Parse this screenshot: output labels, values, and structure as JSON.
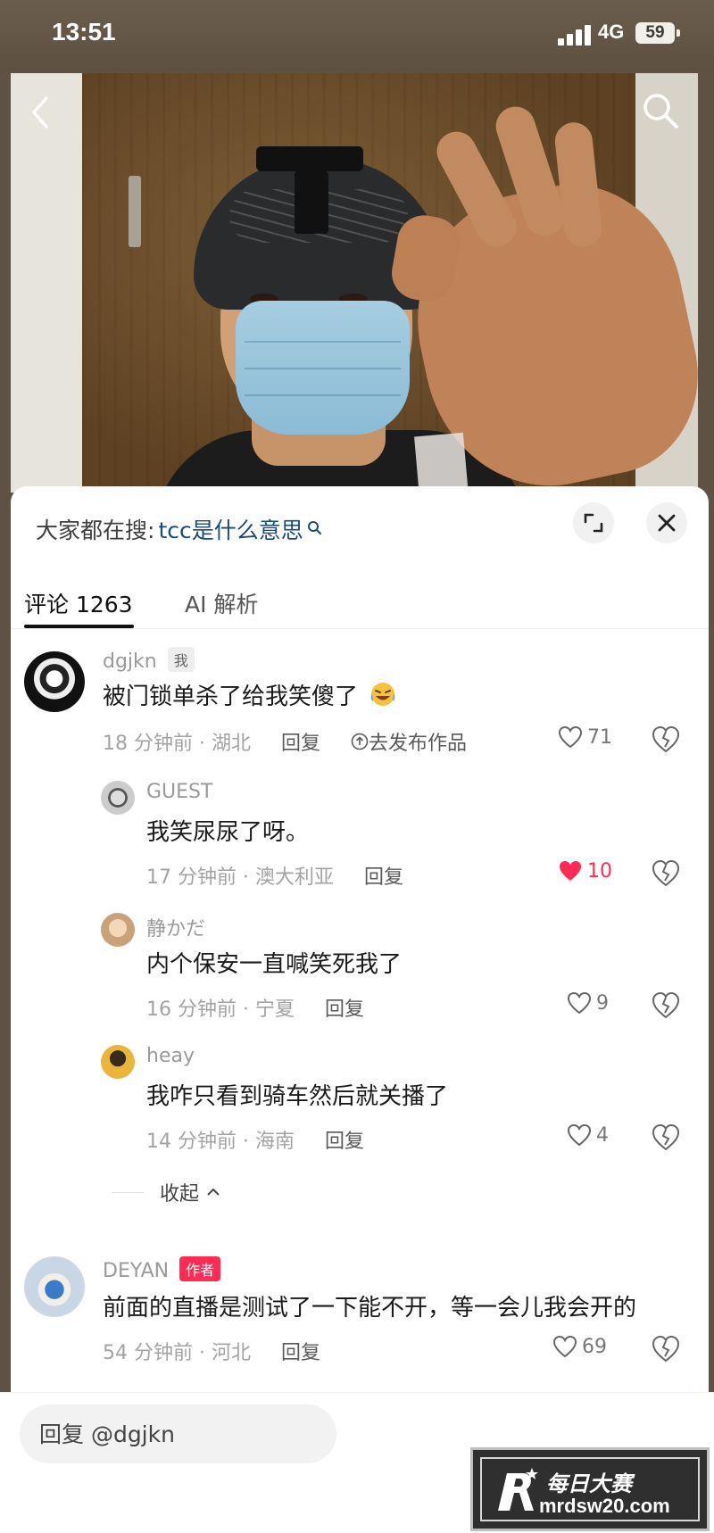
{
  "status_bar": {
    "time": "13:51",
    "network": "4G",
    "battery": "59"
  },
  "video": {
    "back_icon": "chevron-left-icon",
    "search_icon": "search-icon"
  },
  "sheet": {
    "hot_search_prefix": "大家都在搜:",
    "hot_search_keyword": "tcc是什么意思",
    "tabs": [
      {
        "label": "评论 1263",
        "active": true
      },
      {
        "label": "AI 解析",
        "active": false
      }
    ]
  },
  "comments": [
    {
      "user": "dgjkn",
      "tag": "我",
      "text": "被门锁单杀了给我笑傻了",
      "time_location": "18 分钟前 · 湖北",
      "reply_label": "回复",
      "publish_label": "去发布作品",
      "likes": "71"
    },
    {
      "user": "GUEST",
      "text": "我笑尿尿了呀。",
      "time_location": "17 分钟前 · 澳大利亚",
      "reply_label": "回复",
      "likes": "10",
      "liked": true
    },
    {
      "user": "静かだ",
      "text": "内个保安一直喊笑死我了",
      "time_location": "16 分钟前 · 宁夏",
      "reply_label": "回复",
      "likes": "9"
    },
    {
      "user": "heay",
      "text": "我咋只看到骑车然后就关播了",
      "time_location": "14 分钟前 · 海南",
      "reply_label": "回复",
      "likes": "4"
    },
    {
      "user": "DEYAN",
      "tag": "作者",
      "text": "前面的直播是测试了一下能不开，等一会儿我会开的",
      "time_location": "54 分钟前 · 河北",
      "reply_label": "回复",
      "likes": "69"
    }
  ],
  "collapse_label": "收起",
  "reply_bar": {
    "placeholder": "回复 @dgjkn"
  },
  "watermark": {
    "name": "每日大赛",
    "url": "mrdsw20.com"
  },
  "colors": {
    "accent": "#fe2c55",
    "keyword": "#1a4a78"
  }
}
